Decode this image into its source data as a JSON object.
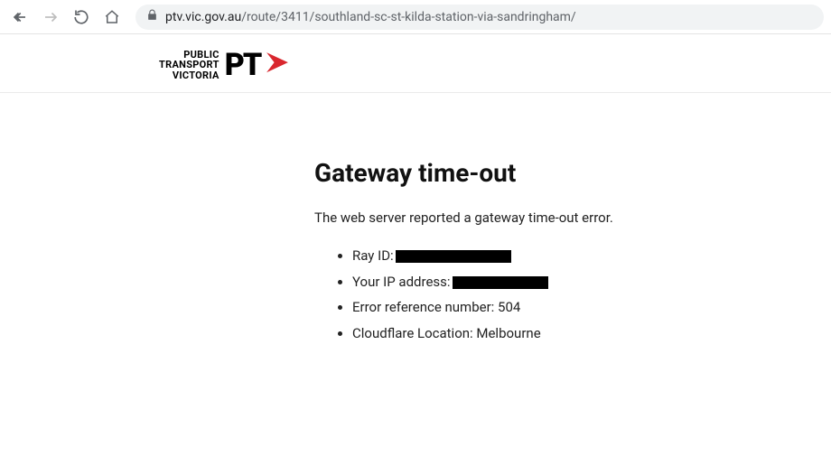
{
  "browser": {
    "url_domain": "ptv.vic.gov.au",
    "url_path": "/route/3411/southland-sc-st-kilda-station-via-sandringham/"
  },
  "logo": {
    "line1": "PUBLIC",
    "line2": "TRANSPORT",
    "line3": "VICTORIA",
    "pt": "PT"
  },
  "error": {
    "title": "Gateway time-out",
    "message": "The web server reported a gateway time-out error.",
    "items": {
      "ray_label": "Ray ID:",
      "ip_label": "Your IP address:",
      "ref_label": "Error reference number: 504",
      "loc_label": "Cloudflare Location: Melbourne"
    }
  }
}
